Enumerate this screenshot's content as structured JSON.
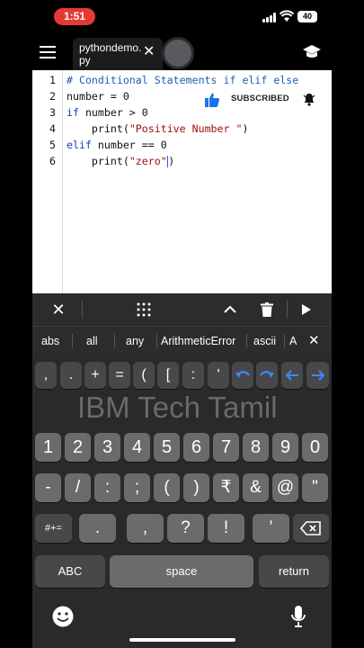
{
  "status": {
    "time": "1:51",
    "battery": "40"
  },
  "tab": {
    "filename": "pythondemo.py"
  },
  "code": [
    {
      "n": "1",
      "parts": [
        {
          "t": "# Conditional Statements if elif else",
          "c": "cm"
        }
      ]
    },
    {
      "n": "2",
      "parts": [
        {
          "t": "number = 0",
          "c": "nm"
        }
      ]
    },
    {
      "n": "3",
      "parts": [
        {
          "t": "if",
          "c": "kw"
        },
        {
          "t": " number > 0",
          "c": "nm"
        }
      ]
    },
    {
      "n": "4",
      "parts": [
        {
          "t": "    print(",
          "c": "nm"
        },
        {
          "t": "\"Positive Number \"",
          "c": "st"
        },
        {
          "t": ")",
          "c": "nm"
        }
      ]
    },
    {
      "n": "5",
      "parts": [
        {
          "t": "elif",
          "c": "kw"
        },
        {
          "t": " number == 0",
          "c": "nm"
        }
      ]
    },
    {
      "n": "6",
      "parts": [
        {
          "t": "    print(",
          "c": "nm"
        },
        {
          "t": "\"zero\"",
          "c": "st"
        },
        {
          "t": ")",
          "c": "nm"
        }
      ]
    }
  ],
  "overlay": {
    "subscribed": "SUBSCRIBED"
  },
  "suggestions": [
    "abs",
    "all",
    "any",
    "ArithmeticError",
    "ascii",
    "A"
  ],
  "symbol_row": [
    ",",
    ".",
    "+",
    "=",
    "(",
    "[",
    ":",
    "'"
  ],
  "watermark": "IBM Tech Tamil",
  "digits": [
    "1",
    "2",
    "3",
    "4",
    "5",
    "6",
    "7",
    "8",
    "9",
    "0"
  ],
  "punct_row": [
    "-",
    "/",
    ":",
    ";",
    "(",
    ")",
    "₹",
    "&",
    "@",
    "\""
  ],
  "row3": {
    "shift": "#+=",
    "keys": [
      ".",
      ",",
      "?",
      "!",
      "’"
    ]
  },
  "bottom": {
    "abc": "ABC",
    "space": "space",
    "return": "return"
  },
  "colors": {
    "accent": "#3d8bff",
    "time_pill": "#e53935"
  }
}
